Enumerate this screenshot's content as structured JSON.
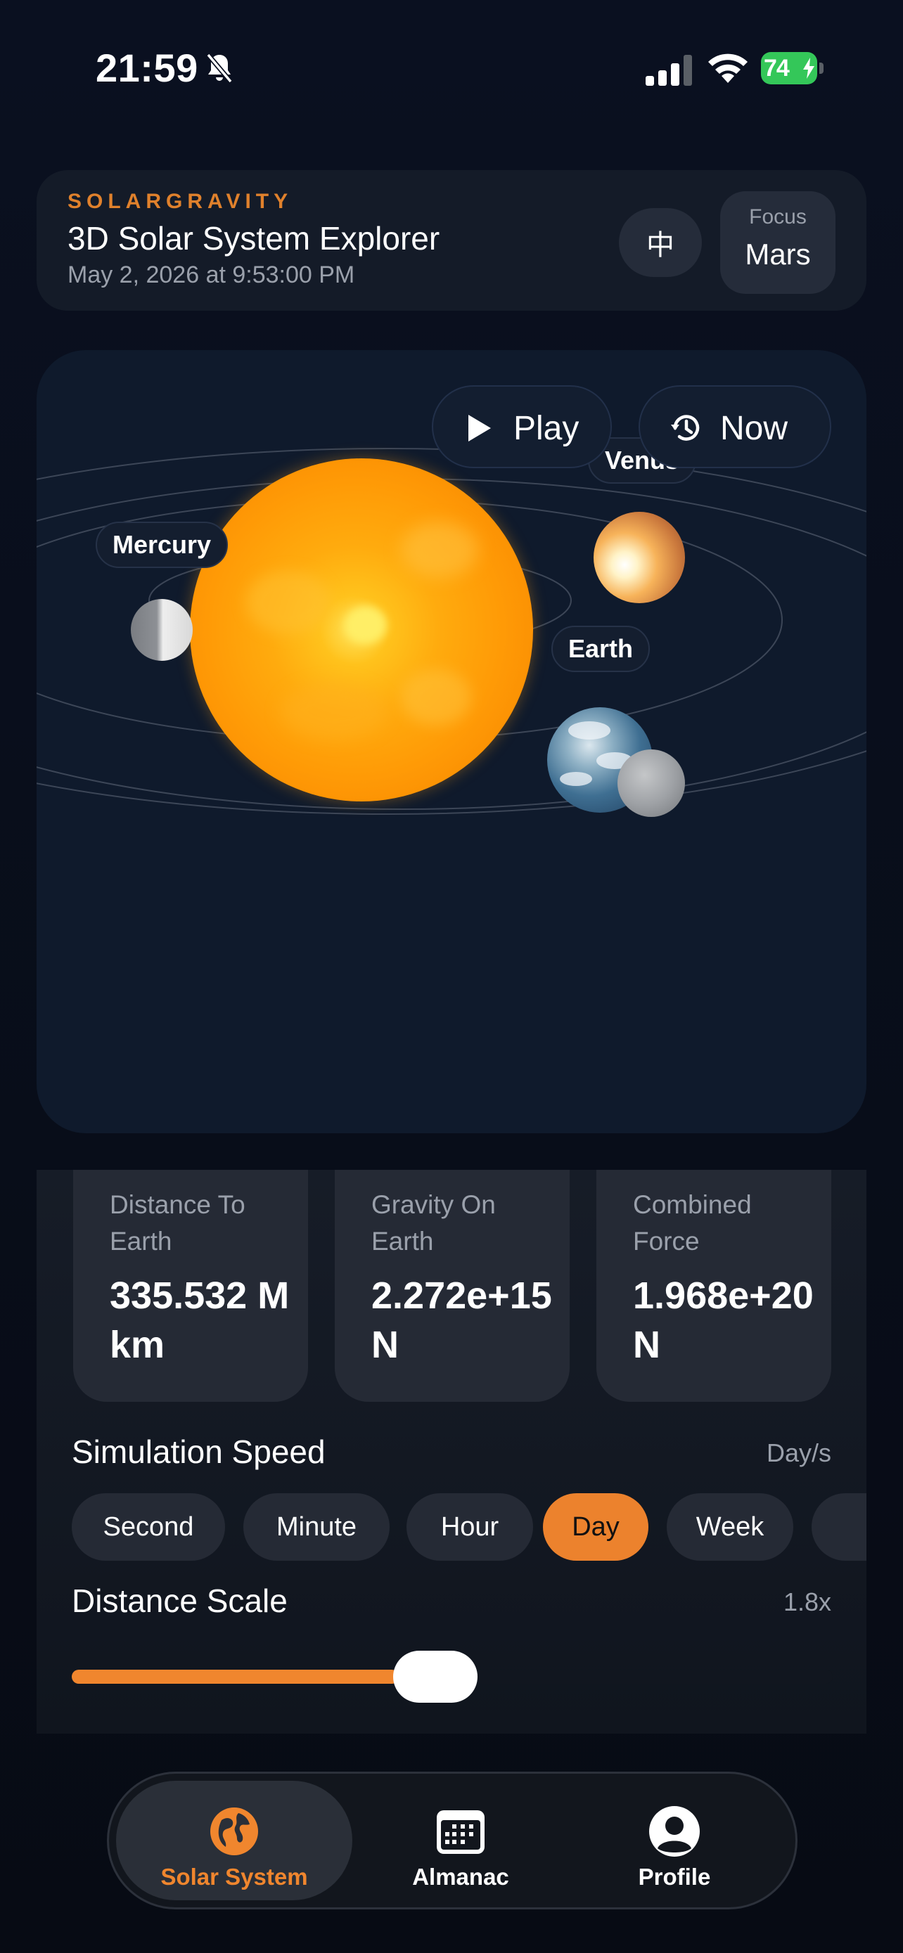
{
  "status_bar": {
    "time": "21:59",
    "battery_percent": "74",
    "icons": [
      "bell-slash-icon",
      "cellular-signal-icon",
      "wifi-icon",
      "battery-charging-icon"
    ]
  },
  "header": {
    "brand": "SOLARGRAVITY",
    "title": "3D Solar System Explorer",
    "date": "May 2, 2026 at 9:53:00 PM",
    "language_button": "中",
    "focus_label": "Focus",
    "focus_value": "Mars"
  },
  "scene": {
    "play_label": "Play",
    "now_label": "Now",
    "planet_labels": {
      "venus": "Venus",
      "mercury": "Mercury",
      "earth": "Earth"
    },
    "bodies": [
      "sun",
      "mercury",
      "venus",
      "earth",
      "moon"
    ]
  },
  "stats": [
    {
      "label": "Distance To Earth",
      "value": "335.532 M km"
    },
    {
      "label": "Gravity On Earth",
      "value": "2.272e+15 N"
    },
    {
      "label": "Combined Force",
      "value": "1.968e+20 N"
    }
  ],
  "simulation_speed": {
    "title": "Simulation Speed",
    "unit": "Day/s",
    "options": [
      "Second",
      "Minute",
      "Hour",
      "Day",
      "Week"
    ],
    "selected": "Day"
  },
  "distance_scale": {
    "title": "Distance Scale",
    "value_label": "1.8x",
    "slider_fraction": 0.43
  },
  "tabbar": {
    "items": [
      {
        "label": "Solar System",
        "icon": "globe-icon",
        "active": true
      },
      {
        "label": "Almanac",
        "icon": "calendar-icon",
        "active": false
      },
      {
        "label": "Profile",
        "icon": "person-circle-icon",
        "active": false
      }
    ]
  },
  "colors": {
    "accent": "#ec822d",
    "background": "#090e18",
    "card": "#252a35"
  }
}
